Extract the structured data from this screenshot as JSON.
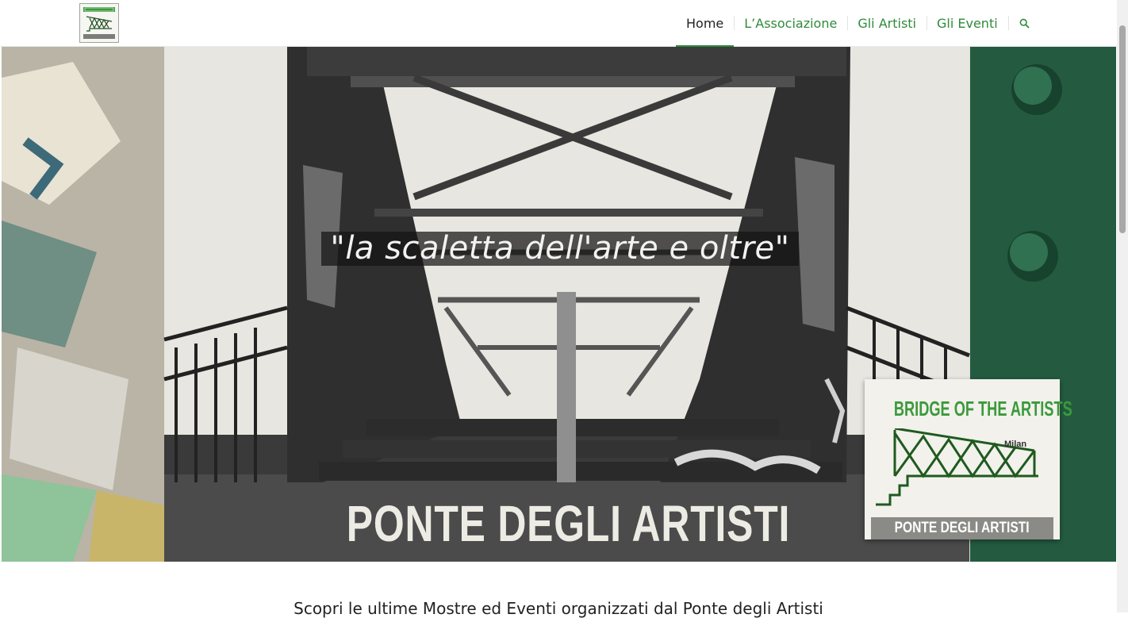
{
  "header": {
    "logo_alt": "Ponte degli Artisti logo",
    "nav": [
      {
        "label": "Home",
        "active": true
      },
      {
        "label": "L’Associazione",
        "active": false
      },
      {
        "label": "Gli Artisti",
        "active": false
      },
      {
        "label": "Gli Eventi",
        "active": false
      }
    ],
    "search_icon": "search-icon"
  },
  "hero": {
    "tagline": "\"la scaletta dell'arte e oltre\"",
    "title": "PONTE DEGLI ARTISTI",
    "badge": {
      "heading": "BRIDGE OF THE ARTISTS",
      "city": "Milan",
      "footer": "PONTE DEGLI ARTISTI"
    }
  },
  "content": {
    "intro": "Scopri le ultime Mostre ed Eventi organizzati dal Ponte degli Artisti"
  },
  "colors": {
    "accent": "#2e8b3a",
    "nav_text": "#2e8b3a",
    "active_text": "#222222"
  }
}
